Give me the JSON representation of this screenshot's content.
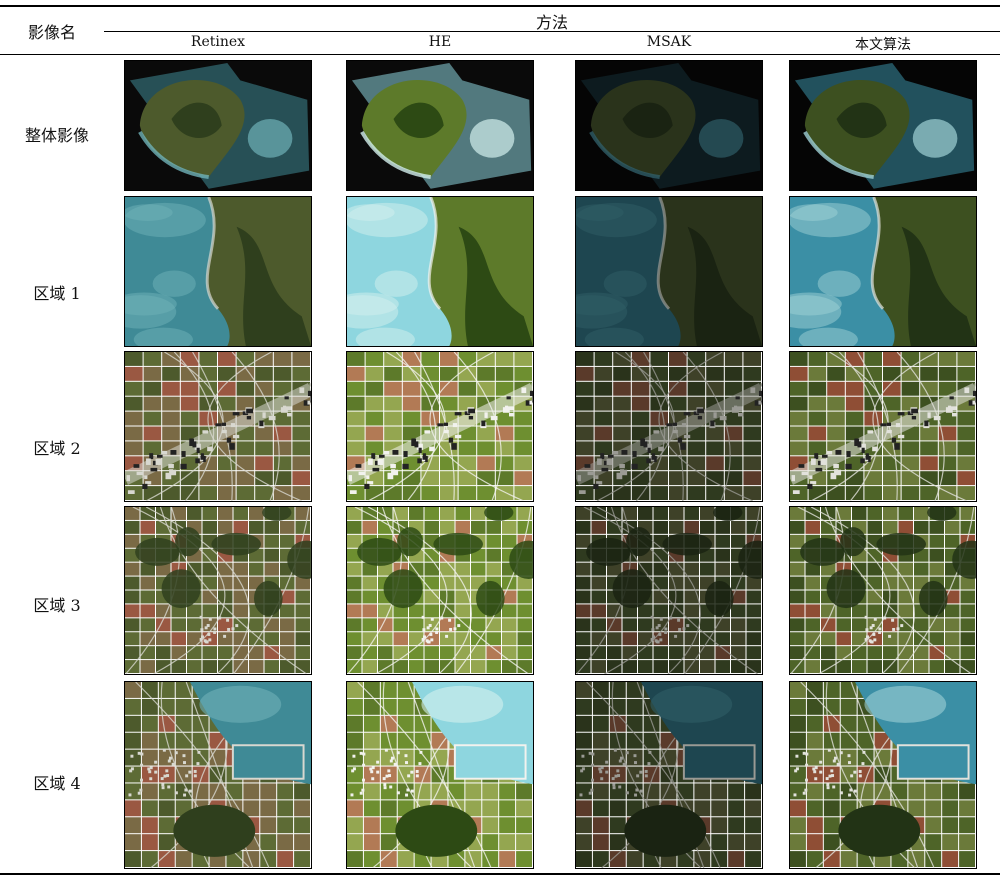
{
  "table": {
    "row_header": "影像名",
    "group_header": "方法",
    "columns": [
      "Retinex",
      "HE",
      "MSAK",
      "本文算法"
    ],
    "rows": [
      {
        "label": "整体影像",
        "kind": "island"
      },
      {
        "label": "区域 1",
        "kind": "coast"
      },
      {
        "label": "区域 2",
        "kind": "town"
      },
      {
        "label": "区域 3",
        "kind": "fields"
      },
      {
        "label": "区域 4",
        "kind": "harbor"
      }
    ]
  },
  "palettes": {
    "Retinex": {
      "sea": "#3f8a96",
      "sea_light": "#6fb1b8",
      "land": "#4d5a2c",
      "forest": "#2f3f1d",
      "field": "#7a6a45",
      "field2": "#5d6b35",
      "red": "#9a5842",
      "road": "#d8d8d0",
      "bg": "#0a0a0a"
    },
    "HE": {
      "sea": "#8ed6df",
      "sea_light": "#d3f0ee",
      "land": "#5d7a2a",
      "forest": "#2d4a14",
      "field": "#94a650",
      "field2": "#6e8f30",
      "red": "#b27a55",
      "road": "#f2f2ee",
      "bg": "#0a0a0a"
    },
    "MSAK": {
      "sea": "#1e4650",
      "sea_light": "#2f5d66",
      "land": "#2a331b",
      "forest": "#1a2312",
      "field": "#3e4128",
      "field2": "#2f3a1f",
      "red": "#5a3a2a",
      "road": "#9a9a94",
      "bg": "#050505"
    },
    "本文算法": {
      "sea": "#3b8fa5",
      "sea_light": "#9fd1d6",
      "land": "#3d5020",
      "forest": "#223315",
      "field": "#6b7a3a",
      "field2": "#4e6428",
      "red": "#8f4e35",
      "road": "#e2e2dc",
      "bg": "#050505"
    }
  }
}
